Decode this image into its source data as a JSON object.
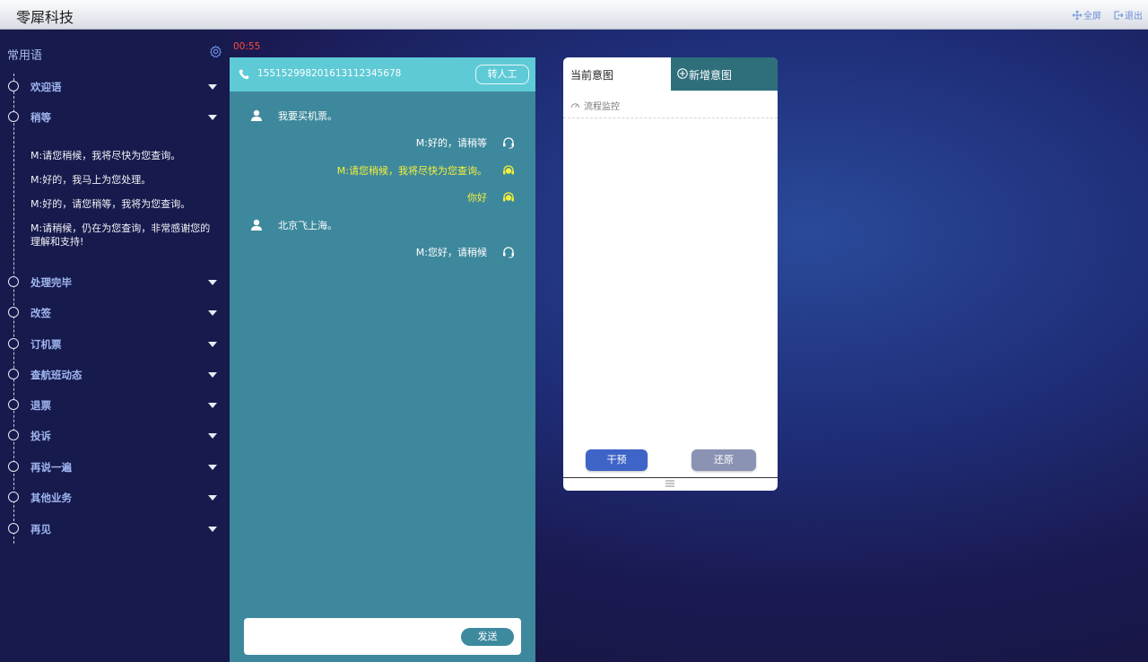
{
  "app": {
    "title": "零犀科技"
  },
  "top_actions": {
    "fullscreen": "全屏",
    "logout": "退出"
  },
  "sidebar": {
    "header": "常用语",
    "items": [
      {
        "label": "欢迎语"
      },
      {
        "label": "稍等"
      },
      {
        "label": "处理完毕"
      },
      {
        "label": "改签"
      },
      {
        "label": "订机票"
      },
      {
        "label": "查航班动态"
      },
      {
        "label": "退票"
      },
      {
        "label": "投诉"
      },
      {
        "label": "再说一遍"
      },
      {
        "label": "其他业务"
      },
      {
        "label": "再见"
      }
    ],
    "sub_items": [
      "M:请您稍候，我将尽快为您查询。",
      "M:好的，我马上为您处理。",
      "M:好的，请您稍等，我将为您查询。",
      "M:请稍候，仍在为您查询，非常感谢您的理解和支持!"
    ]
  },
  "timer": "00:55",
  "chat": {
    "phone_number": "15515299820161311234567­8",
    "transfer_label": "转人工",
    "messages": [
      {
        "side": "left",
        "text": "我要买机票。",
        "icon": "user-icon"
      },
      {
        "side": "right",
        "text": "M:好的，请稍等",
        "icon": "headset-icon",
        "highlight": false
      },
      {
        "side": "right",
        "text": "M:请您稍候，我将尽快为您查询。",
        "icon": "agent-icon",
        "highlight": true
      },
      {
        "side": "right",
        "text": "你好",
        "icon": "agent-icon",
        "highlight": true
      },
      {
        "side": "left",
        "text": "北京飞上海。",
        "icon": "user-icon"
      },
      {
        "side": "right",
        "text": "M:您好，请稍候",
        "icon": "headset-icon",
        "highlight": false
      }
    ],
    "input_value": "",
    "send_label": "发送"
  },
  "intent": {
    "tab_current": "当前意图",
    "tab_new": "新增意图",
    "monitor_label": "流程监控",
    "intervene_label": "干预",
    "restore_label": "还原"
  },
  "colors": {
    "chat_bg": "#3d889c",
    "chat_header": "#5ecad6",
    "highlight_text": "#f4f03a",
    "timer": "#ff4a3a",
    "intervene": "#3f64c7",
    "restore": "#8b93b4"
  }
}
